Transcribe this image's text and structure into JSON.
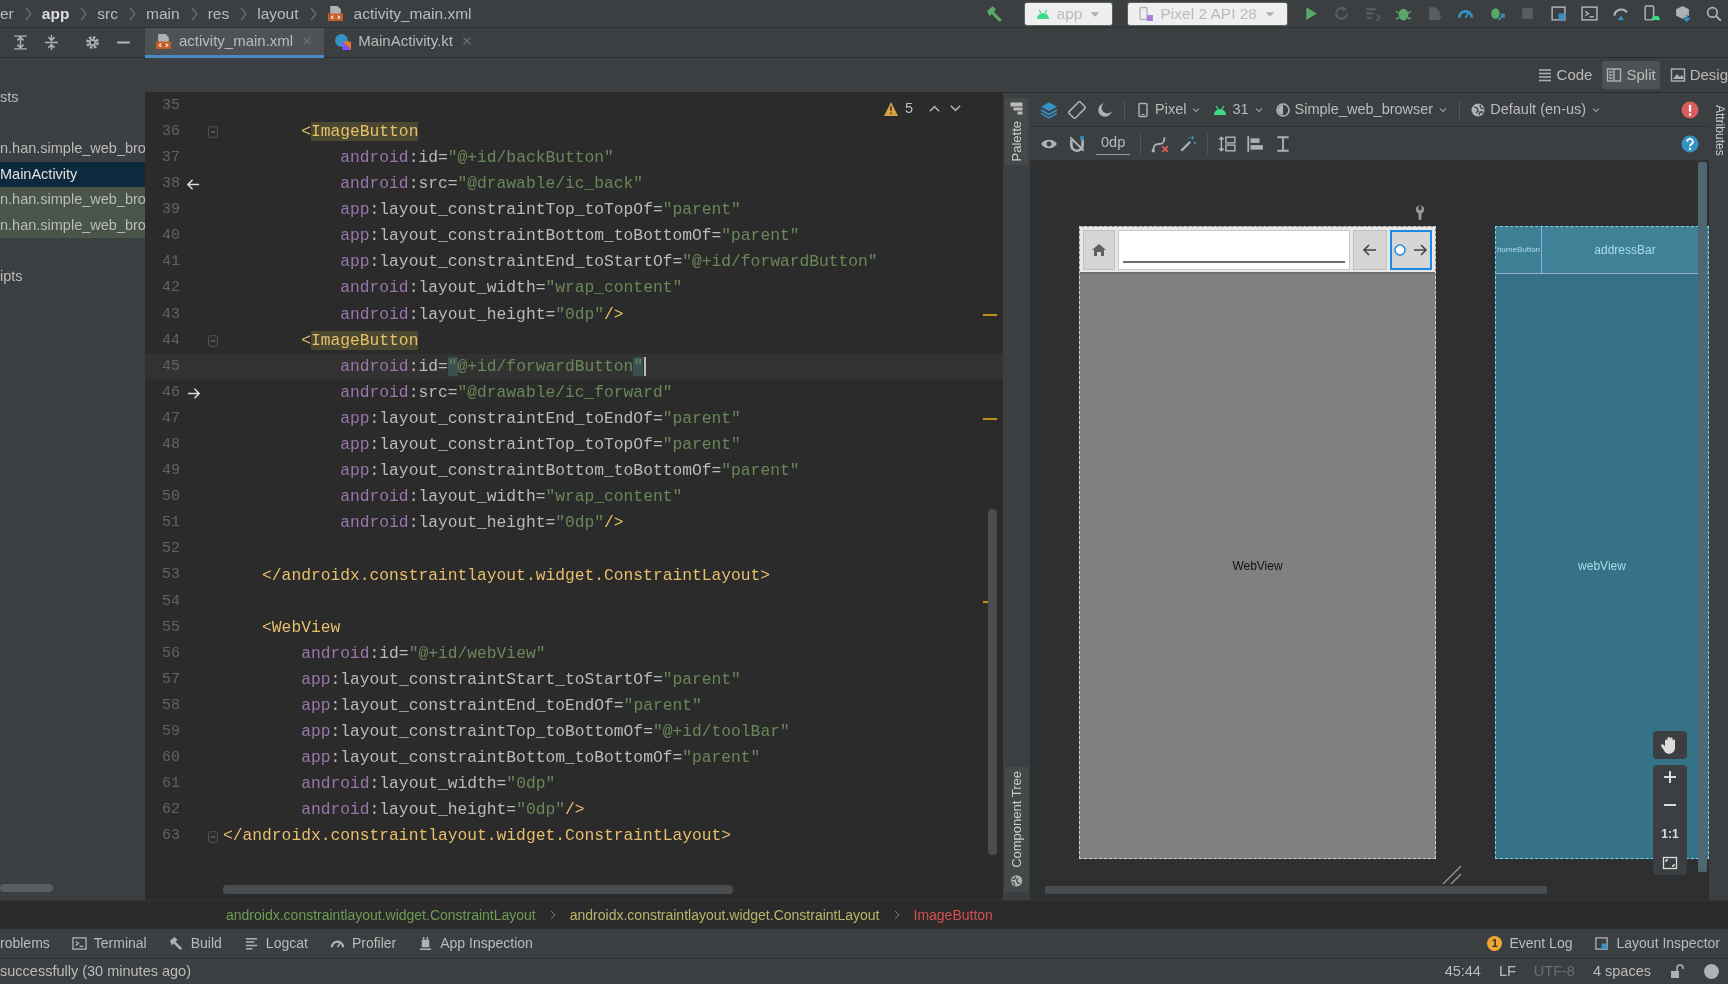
{
  "path_bar": [
    {
      "text": "er",
      "kind": "folder"
    },
    {
      "text": "app",
      "kind": "module"
    },
    {
      "text": "src",
      "kind": "folder"
    },
    {
      "text": "main",
      "kind": "folder"
    },
    {
      "text": "res",
      "kind": "folder"
    },
    {
      "text": "layout",
      "kind": "folder"
    },
    {
      "text": "activity_main.xml",
      "kind": "file"
    }
  ],
  "run_toolbar": {
    "configuration": "app",
    "device": "Pixel 2 API 28"
  },
  "project_tree": [
    {
      "items": [
        {
          "text": "sts",
          "selected": false,
          "kind": "plain"
        }
      ]
    },
    {
      "items": [
        {
          "text": "n.han.simple_web_bro",
          "selected": false,
          "kind": "plain"
        },
        {
          "text": "MainActivity",
          "selected": true,
          "kind": "plain"
        },
        {
          "text": "n.han.simple_web_bro",
          "selected": false,
          "kind": "match"
        },
        {
          "text": "n.han.simple_web_bro",
          "selected": false,
          "kind": "match"
        }
      ]
    },
    {
      "items": [
        {
          "text": "ipts",
          "selected": false,
          "kind": "plain"
        }
      ]
    }
  ],
  "editor_tabs": [
    {
      "label": "activity_main.xml",
      "kind": "xml",
      "selected": true
    },
    {
      "label": "MainActivity.kt",
      "kind": "kotlin",
      "selected": false
    }
  ],
  "view_modes": [
    {
      "label": "Code",
      "kind": "code",
      "selected": false
    },
    {
      "label": "Split",
      "kind": "split",
      "selected": true
    },
    {
      "label": "Desig",
      "kind": "design",
      "selected": false
    }
  ],
  "editor": {
    "warnings": "5",
    "lines": [
      {
        "number": "35"
      },
      {
        "number": "36",
        "fold": true,
        "parts": [
          {
            "kind": "tag",
            "text": "        <"
          },
          {
            "kind": "tag_match",
            "text": "ImageButton"
          }
        ]
      },
      {
        "number": "37",
        "parts": [
          {
            "kind": "ns",
            "text": "            android"
          },
          {
            "kind": "attr",
            "text": ":id="
          },
          {
            "kind": "val",
            "text": "\"@+id/backButton\""
          }
        ]
      },
      {
        "number": "38",
        "gutter": {
          "kind": "back"
        },
        "parts": [
          {
            "kind": "ns",
            "text": "            android"
          },
          {
            "kind": "attr",
            "text": ":src="
          },
          {
            "kind": "val",
            "text": "\"@drawable/ic_back\""
          }
        ]
      },
      {
        "number": "39",
        "parts": [
          {
            "kind": "ns",
            "text": "            app"
          },
          {
            "kind": "attr",
            "text": ":layout_constraintTop_toTopOf="
          },
          {
            "kind": "val",
            "text": "\"parent\""
          }
        ]
      },
      {
        "number": "40",
        "parts": [
          {
            "kind": "ns",
            "text": "            app"
          },
          {
            "kind": "attr",
            "text": ":layout_constraintBottom_toBottomOf="
          },
          {
            "kind": "val",
            "text": "\"parent\""
          }
        ]
      },
      {
        "number": "41",
        "parts": [
          {
            "kind": "ns",
            "text": "            app"
          },
          {
            "kind": "attr",
            "text": ":layout_constraintEnd_toStartOf="
          },
          {
            "kind": "val",
            "text": "\"@+id/forwardButton\""
          }
        ]
      },
      {
        "number": "42",
        "parts": [
          {
            "kind": "ns",
            "text": "            android"
          },
          {
            "kind": "attr",
            "text": ":layout_width="
          },
          {
            "kind": "val",
            "text": "\"wrap_content\""
          }
        ]
      },
      {
        "number": "43",
        "warning_mark": true,
        "parts": [
          {
            "kind": "ns",
            "text": "            android"
          },
          {
            "kind": "attr",
            "text": ":layout_height="
          },
          {
            "kind": "val",
            "text": "\"0dp\""
          },
          {
            "kind": "tag",
            "text": "/>"
          }
        ]
      },
      {
        "number": "44",
        "fold": true,
        "parts": [
          {
            "kind": "tag",
            "text": "        <"
          },
          {
            "kind": "tag_match",
            "text": "ImageButton"
          }
        ]
      },
      {
        "number": "45",
        "current": true,
        "parts": [
          {
            "kind": "ns",
            "text": "            android"
          },
          {
            "kind": "attr",
            "text": ":id="
          },
          {
            "kind": "quote_match",
            "text": "\""
          },
          {
            "kind": "val",
            "text": "@+id/forwardButton"
          },
          {
            "kind": "quote_match",
            "text": "\""
          }
        ]
      },
      {
        "number": "46",
        "gutter": {
          "kind": "forward"
        },
        "parts": [
          {
            "kind": "ns",
            "text": "            android"
          },
          {
            "kind": "attr",
            "text": ":src="
          },
          {
            "kind": "val",
            "text": "\"@drawable/ic_forward\""
          }
        ]
      },
      {
        "number": "47",
        "warning_mark": true,
        "parts": [
          {
            "kind": "ns",
            "text": "            app"
          },
          {
            "kind": "attr",
            "text": ":layout_constraintEnd_toEndOf="
          },
          {
            "kind": "val",
            "text": "\"parent\""
          }
        ]
      },
      {
        "number": "48",
        "parts": [
          {
            "kind": "ns",
            "text": "            app"
          },
          {
            "kind": "attr",
            "text": ":layout_constraintTop_toTopOf="
          },
          {
            "kind": "val",
            "text": "\"parent\""
          }
        ]
      },
      {
        "number": "49",
        "parts": [
          {
            "kind": "ns",
            "text": "            app"
          },
          {
            "kind": "attr",
            "text": ":layout_constraintBottom_toBottomOf="
          },
          {
            "kind": "val",
            "text": "\"parent\""
          }
        ]
      },
      {
        "number": "50",
        "parts": [
          {
            "kind": "ns",
            "text": "            android"
          },
          {
            "kind": "attr",
            "text": ":layout_width="
          },
          {
            "kind": "val",
            "text": "\"wrap_content\""
          }
        ]
      },
      {
        "number": "51",
        "parts": [
          {
            "kind": "ns",
            "text": "            android"
          },
          {
            "kind": "attr",
            "text": ":layout_height="
          },
          {
            "kind": "val",
            "text": "\"0dp\""
          },
          {
            "kind": "tag",
            "text": "/>"
          }
        ]
      },
      {
        "number": "52"
      },
      {
        "number": "53",
        "parts": [
          {
            "kind": "tag",
            "text": "    </androidx.constraintlayout.widget.ConstraintLayout>"
          }
        ]
      },
      {
        "number": "54",
        "warning_mark": true
      },
      {
        "number": "55",
        "parts": [
          {
            "kind": "tag",
            "text": "    <WebView"
          }
        ]
      },
      {
        "number": "56",
        "parts": [
          {
            "kind": "ns",
            "text": "        android"
          },
          {
            "kind": "attr",
            "text": ":id="
          },
          {
            "kind": "val",
            "text": "\"@+id/webView\""
          }
        ]
      },
      {
        "number": "57",
        "parts": [
          {
            "kind": "ns",
            "text": "        app"
          },
          {
            "kind": "attr",
            "text": ":layout_constraintStart_toStartOf="
          },
          {
            "kind": "val",
            "text": "\"parent\""
          }
        ]
      },
      {
        "number": "58",
        "parts": [
          {
            "kind": "ns",
            "text": "        app"
          },
          {
            "kind": "attr",
            "text": ":layout_constraintEnd_toEndOf="
          },
          {
            "kind": "val",
            "text": "\"parent\""
          }
        ]
      },
      {
        "number": "59",
        "parts": [
          {
            "kind": "ns",
            "text": "        app"
          },
          {
            "kind": "attr",
            "text": ":layout_constraintTop_toBottomOf="
          },
          {
            "kind": "val",
            "text": "\"@+id/toolBar\""
          }
        ]
      },
      {
        "number": "60",
        "parts": [
          {
            "kind": "ns",
            "text": "        app"
          },
          {
            "kind": "attr",
            "text": ":layout_constraintBottom_toBottomOf="
          },
          {
            "kind": "val",
            "text": "\"parent\""
          }
        ]
      },
      {
        "number": "61",
        "parts": [
          {
            "kind": "ns",
            "text": "        android"
          },
          {
            "kind": "attr",
            "text": ":layout_width="
          },
          {
            "kind": "val",
            "text": "\"0dp\""
          }
        ]
      },
      {
        "number": "62",
        "parts": [
          {
            "kind": "ns",
            "text": "        android"
          },
          {
            "kind": "attr",
            "text": ":layout_height="
          },
          {
            "kind": "val",
            "text": "\"0dp\""
          },
          {
            "kind": "tag",
            "text": "/>"
          }
        ]
      },
      {
        "number": "63",
        "fold": true,
        "parts": [
          {
            "kind": "tag",
            "text": "</androidx.constraintlayout.widget.ConstraintLayout>"
          }
        ]
      }
    ]
  },
  "design": {
    "device": "Pixel",
    "api_level": "31",
    "theme": "Simple_web_browser",
    "locale": "Default (en-us)",
    "default_margin": "0dp",
    "side_tabs": {
      "palette": "Palette",
      "component_tree": "Component Tree",
      "attributes": "Attributes"
    },
    "preview": {
      "web_view_label": "WebView"
    },
    "blueprint": {
      "home_button_label": "homeButton",
      "address_bar_label": "addressBar",
      "web_view_label": "webView"
    },
    "zoom_reset": "1:1"
  },
  "component_path": [
    {
      "text": "androidx.constraintlayout.widget.ConstraintLayout",
      "color": "#6e9c54"
    },
    {
      "text": "androidx.constraintlayout.widget.ConstraintLayout",
      "color": "#bab56a"
    },
    {
      "text": "ImageButton",
      "color": "#d25050"
    }
  ],
  "tool_windows": [
    {
      "label": "roblems",
      "kind": "problems"
    },
    {
      "label": "Terminal",
      "kind": "terminal"
    },
    {
      "label": "Build",
      "kind": "build"
    },
    {
      "label": "Logcat",
      "kind": "logcat"
    },
    {
      "label": "Profiler",
      "kind": "profiler"
    },
    {
      "label": "App Inspection",
      "kind": "inspection"
    }
  ],
  "tool_windows_right": [
    {
      "label": "Event Log",
      "kind": "event",
      "badge": "1"
    },
    {
      "label": "Layout Inspector",
      "kind": "layout"
    }
  ],
  "status_bar": {
    "message": "successfully (30 minutes ago)",
    "items": [
      {
        "text": "45:44",
        "disabled": false
      },
      {
        "text": "LF",
        "disabled": false
      },
      {
        "text": "UTF-8",
        "disabled": true
      },
      {
        "text": "4 spaces",
        "disabled": false
      }
    ]
  }
}
